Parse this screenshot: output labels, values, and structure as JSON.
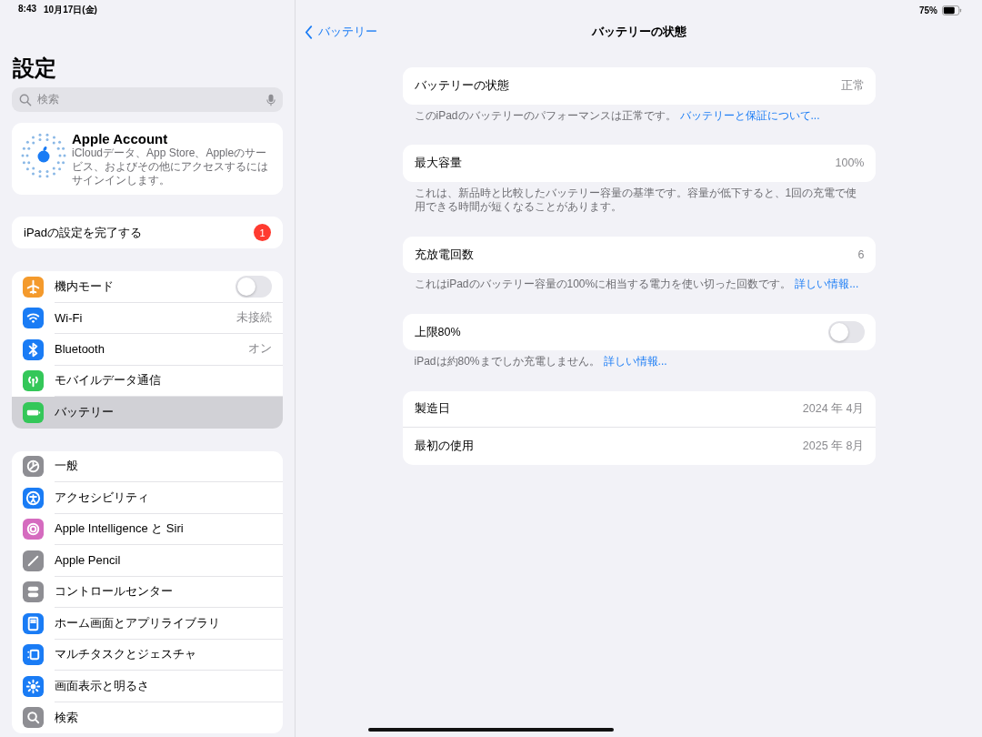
{
  "status_bar": {
    "time": "8:43",
    "date": "10月17日(金)",
    "battery": "75%"
  },
  "sidebar": {
    "title": "設定",
    "search": {
      "placeholder": "検索"
    },
    "account": {
      "name": "Apple Account",
      "description": "iCloudデータ、App Store、Appleのサービス、およびその他にアクセスするにはサインインします。"
    },
    "setup": {
      "label": "iPadの設定を完了する",
      "badge": "1"
    },
    "groups": [
      {
        "items": [
          {
            "label": "機内モード",
            "kind": "toggle",
            "on": false,
            "color": "#f49a2c",
            "selected": false
          },
          {
            "label": "Wi-Fi",
            "kind": "value",
            "value": "未接続",
            "color": "#1a7cf5",
            "selected": false
          },
          {
            "label": "Bluetooth",
            "kind": "value",
            "value": "オン",
            "color": "#1a7cf5",
            "selected": false
          },
          {
            "label": "モバイルデータ通信",
            "kind": "plain",
            "color": "#34c759",
            "selected": false
          },
          {
            "label": "バッテリー",
            "kind": "plain",
            "color": "#34c759",
            "selected": true
          }
        ]
      },
      {
        "items": [
          {
            "label": "一般",
            "kind": "plain",
            "color": "#8e8e93",
            "selected": false
          },
          {
            "label": "アクセシビリティ",
            "kind": "plain",
            "color": "#1a7cf5",
            "selected": false
          },
          {
            "label": "Apple Intelligence と Siri",
            "kind": "plain",
            "color": "#d56bbf",
            "selected": false
          },
          {
            "label": "Apple Pencil",
            "kind": "plain",
            "color": "#8e8e93",
            "selected": false
          },
          {
            "label": "コントロールセンター",
            "kind": "plain",
            "color": "#8e8e93",
            "selected": false
          },
          {
            "label": "ホーム画面とアプリライブラリ",
            "kind": "plain",
            "color": "#1a7cf5",
            "selected": false
          },
          {
            "label": "マルチタスクとジェスチャ",
            "kind": "plain",
            "color": "#1a7cf5",
            "selected": false
          },
          {
            "label": "画面表示と明るさ",
            "kind": "plain",
            "color": "#1a7cf5",
            "selected": false
          },
          {
            "label": "検索",
            "kind": "plain",
            "color": "#8e8e93",
            "selected": false
          }
        ]
      }
    ]
  },
  "nav": {
    "back": "バッテリー",
    "title": "バッテリーの状態"
  },
  "sections": [
    {
      "rows": [
        {
          "label": "バッテリーの状態",
          "kind": "value",
          "value": "正常"
        }
      ],
      "footer": {
        "text": "このiPadのバッテリーのパフォーマンスは正常です。",
        "link": "バッテリーと保証について..."
      }
    },
    {
      "rows": [
        {
          "label": "最大容量",
          "kind": "value",
          "value": "100%"
        }
      ],
      "footer": {
        "text": "これは、新品時と比較したバッテリー容量の基準です。容量が低下すると、1回の充電で使用できる時間が短くなることがあります。"
      }
    },
    {
      "rows": [
        {
          "label": "充放電回数",
          "kind": "value",
          "value": "6"
        }
      ],
      "footer": {
        "text": "これはiPadのバッテリー容量の100%に相当する電力を使い切った回数です。",
        "link": "詳しい情報..."
      }
    },
    {
      "rows": [
        {
          "label": "上限80%",
          "kind": "toggle",
          "on": false
        }
      ],
      "footer": {
        "text": "iPadは約80%までしか充電しません。",
        "link": "詳しい情報..."
      }
    },
    {
      "rows": [
        {
          "label": "製造日",
          "kind": "value",
          "value": "2024 年 4月"
        },
        {
          "label": "最初の使用",
          "kind": "value",
          "value": "2025 年 8月"
        }
      ]
    }
  ]
}
